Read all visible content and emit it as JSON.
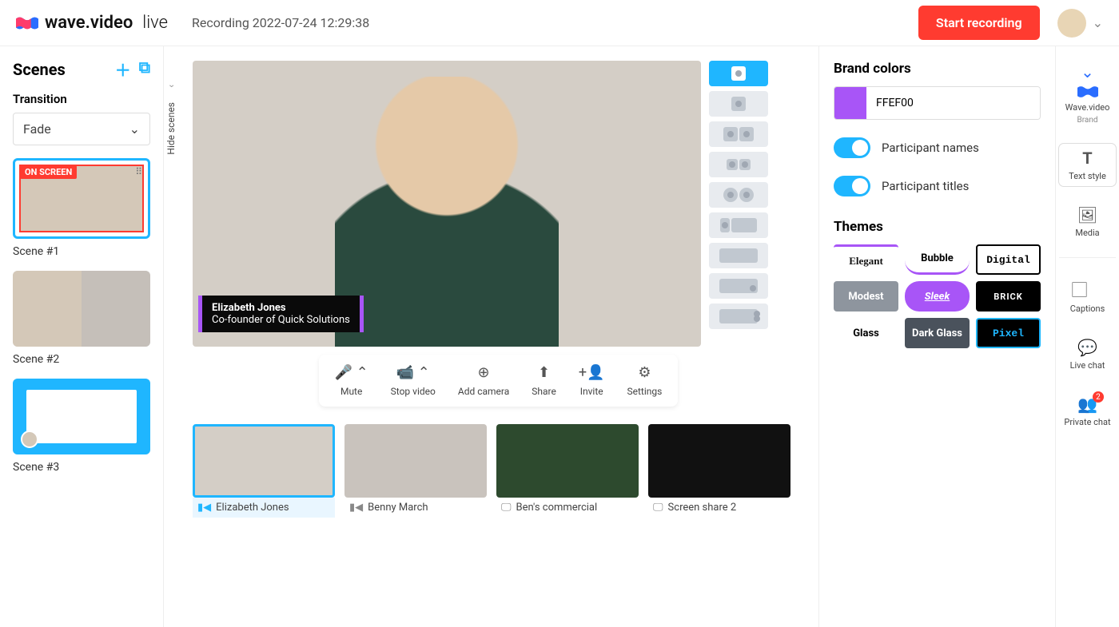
{
  "header": {
    "brand": "wave.video",
    "brand_suffix": "live",
    "recording_title": "Recording 2022-07-24 12:29:38",
    "start_btn": "Start recording"
  },
  "left": {
    "scenes_title": "Scenes",
    "transition_title": "Transition",
    "transition_value": "Fade",
    "hide_label": "Hide scenes",
    "scenes": [
      {
        "label": "Scene #1",
        "badge": "ON SCREEN"
      },
      {
        "label": "Scene #2"
      },
      {
        "label": "Scene #3"
      }
    ]
  },
  "stage": {
    "lower_third": {
      "name": "Elizabeth Jones",
      "title": "Co-founder of Quick Solutions"
    },
    "controls": {
      "mute": "Mute",
      "stop_video": "Stop video",
      "add_camera": "Add camera",
      "share": "Share",
      "invite": "Invite",
      "settings": "Settings"
    },
    "participants": [
      {
        "name": "Elizabeth Jones",
        "type": "cam",
        "active": true
      },
      {
        "name": "Benny March",
        "type": "cam"
      },
      {
        "name": "Ben's commercial",
        "type": "screen"
      },
      {
        "name": "Screen share 2",
        "type": "screen"
      }
    ]
  },
  "right": {
    "brand_colors_title": "Brand colors",
    "color_value": "FFEF00",
    "participant_names": "Participant names",
    "participant_titles": "Participant titles",
    "themes_title": "Themes",
    "themes": [
      {
        "label": "Elegant",
        "style": "font-family:serif;color:#111;background:#fff;border-top:3px solid #a855f7;"
      },
      {
        "label": "Bubble",
        "style": "background:#fff;border-bottom:3px solid #a855f7;border-radius:18px;"
      },
      {
        "label": "Digital",
        "style": "background:#fff;border:2px solid #000;font-family:'Courier New',monospace;"
      },
      {
        "label": "Modest",
        "style": "background:#8e959e;color:#fff;"
      },
      {
        "label": "Sleek",
        "style": "background:#a855f7;color:#fff;font-style:italic;border-radius:18px;text-decoration:underline;"
      },
      {
        "label": "BRICK",
        "style": "background:#000;color:#fff;letter-spacing:1px;font-size:11px;"
      },
      {
        "label": "Glass",
        "style": "background:#fff;"
      },
      {
        "label": "Dark Glass",
        "style": "background:#4a525c;color:#fff;"
      },
      {
        "label": "Pixel",
        "style": "background:#000;color:#1fb6ff;font-family:'Courier New',monospace;",
        "active": true
      }
    ]
  },
  "rail": {
    "brand": {
      "label": "Wave.video",
      "sub": "Brand"
    },
    "text_style": "Text style",
    "media": "Media",
    "captions": "Captions",
    "live_chat": "Live chat",
    "private_chat": "Private chat",
    "private_badge": "2"
  }
}
